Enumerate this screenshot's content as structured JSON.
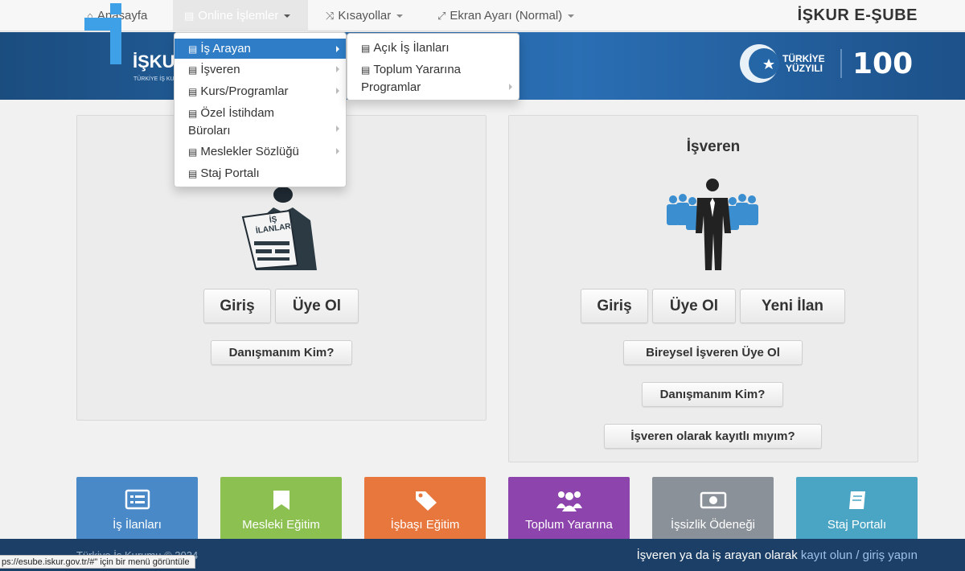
{
  "nav": {
    "home": "Anasayfa",
    "online": "Online İşlemler",
    "shortcuts": "Kısayollar",
    "screen": "Ekran Ayarı (Normal)",
    "brand": "İŞKUR E-ŞUBE"
  },
  "banner": {
    "logo_text": "İŞKUR",
    "logo_sub": "TÜRKİYE İŞ KURUMU",
    "tr_line1": "TÜRKİYE",
    "tr_line2": "YÜZYILI"
  },
  "online_menu": {
    "items": [
      "İş Arayan",
      "İşveren",
      "Kurs/Programlar",
      "Özel İstihdam",
      "Büroları",
      "Meslekler Sözlüğü",
      "Staj Portalı"
    ],
    "sub_items": [
      "Açık İş İlanları",
      "Toplum Yararına",
      "Programlar"
    ]
  },
  "job_seeker": {
    "login": "Giriş",
    "register": "Üye Ol",
    "advisor": "Danışmanım Kim?",
    "newspaper_text": "İŞ İLANLARI"
  },
  "employer": {
    "title": "İşveren",
    "login": "Giriş",
    "register": "Üye Ol",
    "new_ad": "Yeni İlan",
    "individual": "Bireysel İşveren Üye Ol",
    "advisor": "Danışmanım Kim?",
    "registered": "İşveren olarak kayıtlı mıyım?"
  },
  "tiles": [
    {
      "label": "İş İlanları",
      "color": "#4a89c8"
    },
    {
      "label": "Mesleki Eğitim",
      "color": "#8cc152"
    },
    {
      "label": "İşbaşı Eğitim",
      "color": "#e8773d"
    },
    {
      "label": "Toplum Yararına",
      "color": "#8e44ad"
    },
    {
      "label": "İşsizlik Ödeneği",
      "color": "#8a9199"
    },
    {
      "label": "Staj Portalı",
      "color": "#4aa5c4"
    }
  ],
  "footer": {
    "copyright": "Türkiye İş Kurumu © 2024",
    "prompt": "İşveren ya da iş arayan olarak",
    "register_link": "kayıt olun",
    "separator": "/",
    "login_link": "giriş yapın"
  },
  "status_url": "ps://esube.iskur.gov.tr/#\" için bir menü görüntüle"
}
